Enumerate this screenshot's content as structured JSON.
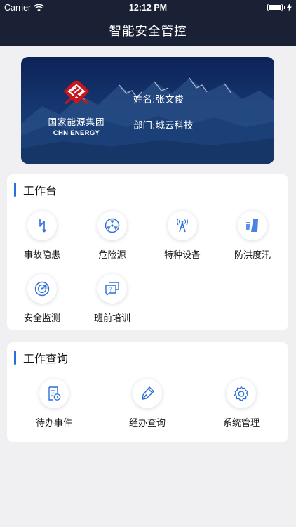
{
  "status_bar": {
    "carrier": "Carrier",
    "time": "12:12 PM"
  },
  "header": {
    "title": "智能安全管控"
  },
  "banner": {
    "logo_cn": "国家能源集团",
    "logo_en": "CHN ENERGY",
    "name": "姓名:张文俊",
    "department": "部门:城云科技"
  },
  "workbench": {
    "title": "工作台",
    "items": [
      {
        "label": "事故隐患",
        "icon": "lightning-icon"
      },
      {
        "label": "危险源",
        "icon": "radiation-icon"
      },
      {
        "label": "特种设备",
        "icon": "signal-tower-icon"
      },
      {
        "label": "防洪度汛",
        "icon": "flood-icon"
      },
      {
        "label": "安全监测",
        "icon": "radar-icon"
      },
      {
        "label": "班前培训",
        "icon": "question-chat-icon"
      }
    ]
  },
  "query": {
    "title": "工作查询",
    "items": [
      {
        "label": "待办事件",
        "icon": "todo-document-icon"
      },
      {
        "label": "经办查询",
        "icon": "pen-icon"
      },
      {
        "label": "系统管理",
        "icon": "gear-icon"
      }
    ]
  },
  "colors": {
    "header_bg": "#1a2134",
    "accent": "#2c6fd9",
    "logo_red": "#c8161d",
    "page_bg": "#f0f0f2"
  }
}
